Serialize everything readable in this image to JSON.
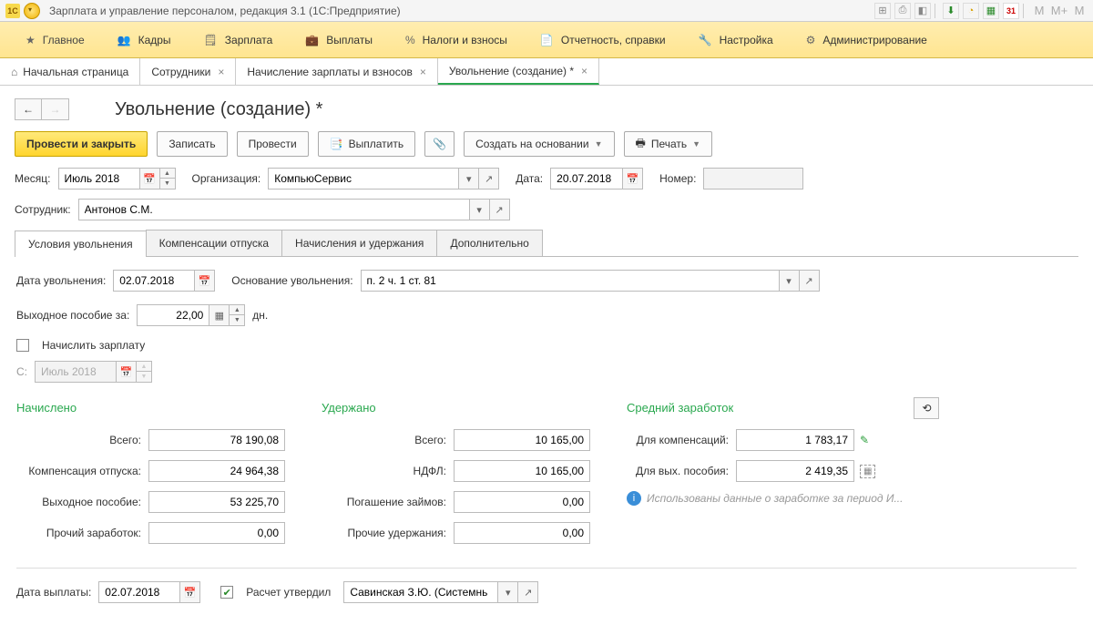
{
  "window": {
    "title": "Зарплата и управление персоналом, редакция 3.1  (1С:Предприятие)"
  },
  "main_menu": {
    "items": [
      {
        "label": "Главное",
        "icon": "star"
      },
      {
        "label": "Кадры",
        "icon": "people"
      },
      {
        "label": "Зарплата",
        "icon": "calc"
      },
      {
        "label": "Выплаты",
        "icon": "briefcase"
      },
      {
        "label": "Налоги и взносы",
        "icon": "percent"
      },
      {
        "label": "Отчетность, справки",
        "icon": "report"
      },
      {
        "label": "Настройка",
        "icon": "wrench"
      },
      {
        "label": "Администрирование",
        "icon": "gear"
      }
    ]
  },
  "tabs": {
    "items": [
      {
        "label": "Начальная страница",
        "closable": false,
        "home": true
      },
      {
        "label": "Сотрудники",
        "closable": true
      },
      {
        "label": "Начисление зарплаты и взносов",
        "closable": true
      },
      {
        "label": "Увольнение (создание) *",
        "closable": true,
        "active": true
      }
    ]
  },
  "page": {
    "title": "Увольнение (создание) *"
  },
  "toolbar": {
    "post_close": "Провести и закрыть",
    "save": "Записать",
    "post": "Провести",
    "pay": "Выплатить",
    "create_on_basis": "Создать на основании",
    "print": "Печать"
  },
  "header_form": {
    "month_label": "Месяц:",
    "month_value": "Июль 2018",
    "org_label": "Организация:",
    "org_value": "КомпьюСервис",
    "date_label": "Дата:",
    "date_value": "20.07.2018",
    "number_label": "Номер:",
    "number_value": "",
    "employee_label": "Сотрудник:",
    "employee_value": "Антонов С.М."
  },
  "subtabs": {
    "items": [
      {
        "label": "Условия увольнения",
        "active": true
      },
      {
        "label": "Компенсации отпуска"
      },
      {
        "label": "Начисления и удержания"
      },
      {
        "label": "Дополнительно"
      }
    ]
  },
  "dismissal": {
    "date_label": "Дата увольнения:",
    "date_value": "02.07.2018",
    "basis_label": "Основание увольнения:",
    "basis_value": "п. 2 ч. 1 ст. 81",
    "severance_label": "Выходное пособие за:",
    "severance_days": "22,00",
    "days_suffix": "дн.",
    "accrue_salary_label": "Начислить зарплату",
    "from_label": "С:",
    "from_value": "Июль 2018"
  },
  "summary": {
    "accrued_title": "Начислено",
    "withheld_title": "Удержано",
    "avg_title": "Средний заработок",
    "total_label": "Всего:",
    "total_accrued": "78 190,08",
    "total_withheld": "10 165,00",
    "comp_leave_label": "Компенсация отпуска:",
    "comp_leave": "24 964,38",
    "ndfl_label": "НДФЛ:",
    "ndfl": "10 165,00",
    "severance_label": "Выходное пособие:",
    "severance": "53 225,70",
    "loan_repay_label": "Погашение займов:",
    "loan_repay": "0,00",
    "other_income_label": "Прочий заработок:",
    "other_income": "0,00",
    "other_withhold_label": "Прочие удержания:",
    "other_withhold": "0,00",
    "for_comp_label": "Для компенсаций:",
    "for_comp": "1 783,17",
    "for_sev_label": "Для вых. пособия:",
    "for_sev": "2 419,35",
    "info_text": "Использованы данные о заработке за период И..."
  },
  "footer": {
    "pay_date_label": "Дата выплаты:",
    "pay_date": "02.07.2018",
    "approved_label": "Расчет утвердил",
    "approved_by": "Савинская З.Ю. (Системнь"
  }
}
